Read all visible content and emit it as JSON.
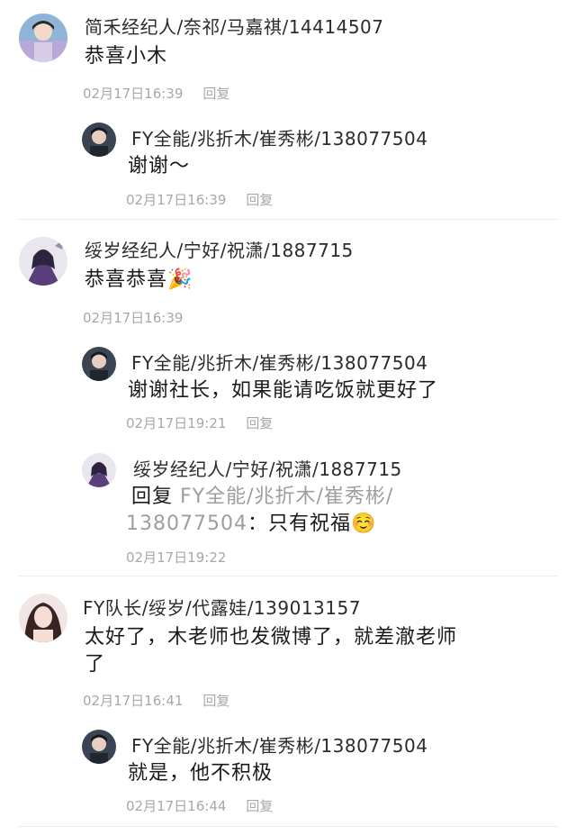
{
  "comments": [
    {
      "name": "简禾经纪人/奈祁/马嘉祺/14414507",
      "text": "恭喜小木",
      "time": "02月17日16:39",
      "reply": "回复",
      "replies": [
        {
          "name": "FY全能/兆折木/崔秀彬/138077504",
          "text": "谢谢～",
          "time": "02月17日16:39",
          "reply": "回复"
        }
      ]
    },
    {
      "name": "绥岁经纪人/宁好/祝潇/1887715",
      "text": "恭喜恭喜",
      "emoji": "🎉",
      "time": "02月17日16:39",
      "replies": [
        {
          "name": "FY全能/兆折木/崔秀彬/138077504",
          "text": "谢谢社长，如果能请吃饭就更好了",
          "time": "02月17日19:21",
          "reply": "回复"
        },
        {
          "name": "绥岁经纪人/宁好/祝潇/1887715",
          "reply_prefix": "回复",
          "quoted": "FY全能/兆折木/崔秀彬/",
          "quoted2": "138077504",
          "text": "：只有祝福",
          "emoji": "☺️",
          "time": "02月17日19:22"
        }
      ]
    },
    {
      "name": "FY队长/绥岁/代露娃/139013157",
      "text": "太好了，木老师也发微博了，就差澈老师",
      "text2": "了",
      "time": "02月17日16:41",
      "reply": "回复",
      "replies": [
        {
          "name": "FY全能/兆折木/崔秀彬/138077504",
          "text": "就是，他不积极",
          "time": "02月17日16:44",
          "reply": "回复"
        }
      ]
    }
  ]
}
